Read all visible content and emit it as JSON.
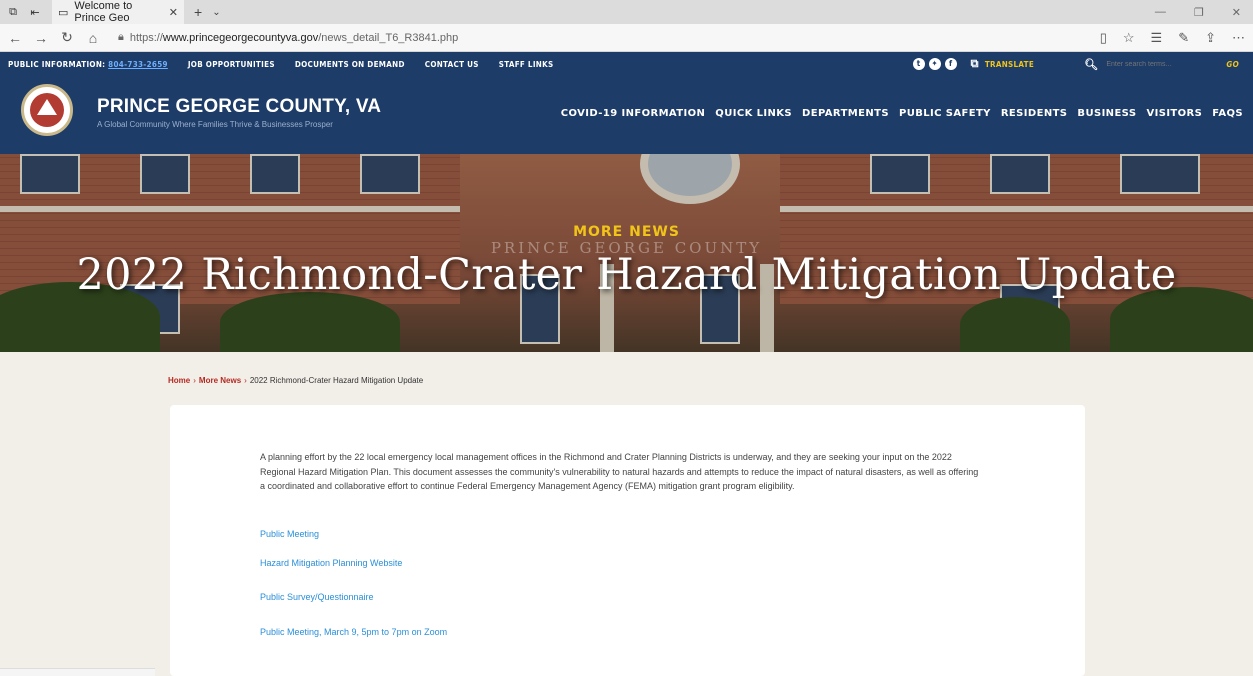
{
  "browser": {
    "tab_title": "Welcome to Prince Geo",
    "url_prefix": "https://",
    "url_domain": "www.princegeorgecountyva.gov",
    "url_path": "/news_detail_T6_R3841.php"
  },
  "utility": {
    "public_info_label": "PUBLIC INFORMATION:",
    "phone": "804-733-2659",
    "links": [
      "JOB OPPORTUNITIES",
      "DOCUMENTS ON DEMAND",
      "CONTACT US",
      "STAFF LINKS"
    ],
    "translate": "TRANSLATE",
    "search_placeholder": "Enter search terms...",
    "go": "GO"
  },
  "header": {
    "name": "PRINCE GEORGE COUNTY, VA",
    "tagline": "A Global Community Where Families Thrive & Businesses Prosper",
    "nav": [
      "COVID-19 INFORMATION",
      "QUICK LINKS",
      "DEPARTMENTS",
      "PUBLIC SAFETY",
      "RESIDENTS",
      "BUSINESS",
      "VISITORS",
      "FAQS"
    ]
  },
  "hero": {
    "section": "MORE NEWS",
    "watermark": "PRINCE GEORGE COUNTY",
    "title": "2022 Richmond-Crater Hazard Mitigation Update"
  },
  "breadcrumb": {
    "home": "Home",
    "more_news": "More News",
    "current": "2022 Richmond-Crater Hazard Mitigation Update"
  },
  "article": {
    "body": "A planning effort by the 22 local emergency local management offices in the Richmond and Crater Planning Districts is underway, and they are seeking your input on the 2022 Regional Hazard Mitigation Plan. This document assesses the community's vulnerability to natural hazards and attempts to reduce the impact of natural disasters, as well as offering a coordinated and collaborative effort to continue Federal Emergency Management Agency (FEMA) mitigation grant program eligibility.",
    "links": [
      "Public Meeting",
      "Hazard Mitigation Planning Website",
      "Public Survey/Questionnaire",
      "Public Meeting, March 9, 5pm to 7pm on Zoom"
    ]
  },
  "colors": {
    "navy": "#1d3c68",
    "gold": "#f0c419",
    "breadcrumb_red": "#b52a22",
    "link_blue": "#2a8fd8"
  }
}
